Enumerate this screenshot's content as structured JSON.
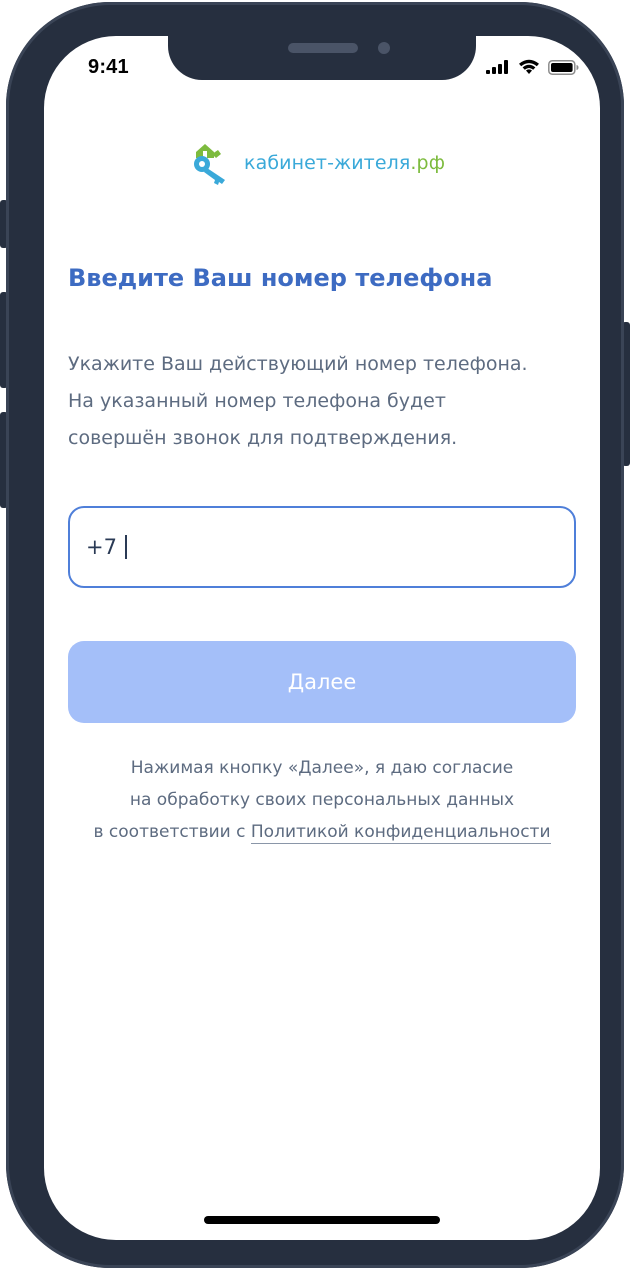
{
  "status_bar": {
    "time": "9:41",
    "icons": [
      "signal-icon",
      "wifi-icon",
      "battery-icon"
    ]
  },
  "logo": {
    "name": "кабинет-жителя",
    "tld": ".рф",
    "icon": "house-key-logo-icon",
    "colors": {
      "primary": "#3aa9d9",
      "accent": "#7dbb3e"
    }
  },
  "screen": {
    "title": "Введите Ваш номер телефона",
    "description_lines": [
      "Укажите Ваш действующий номер телефона.",
      "На указанный номер телефона будет",
      "совершён звонок для подтверждения."
    ]
  },
  "phone_field": {
    "value": "+7"
  },
  "next_button": {
    "label": "Далее",
    "state": "disabled",
    "color": "#a4bff9"
  },
  "consent": {
    "line1": "Нажимая кнопку «Далее», я даю согласие",
    "line2": "на обработку своих персональных данных",
    "line3_prefix": "в соответствии с",
    "policy_link": "Политикой конфиденциальности"
  },
  "theme": {
    "accent": "#3d6bc2",
    "input_border": "#4f7fd9",
    "text_secondary": "#5d6b80",
    "device_frame": "#262f3f"
  }
}
